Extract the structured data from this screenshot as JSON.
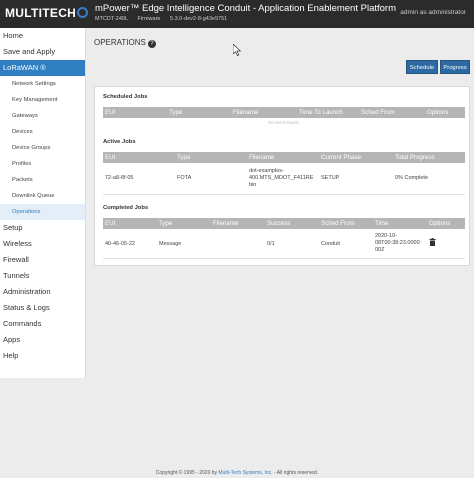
{
  "header": {
    "logo_text": "MULTITECH",
    "title": "mPower™ Edge Intelligence Conduit - Application Enablement Platform",
    "model": "MTCDT-240L",
    "firmware_label": "Firmware",
    "firmware_version": "5.3.0-dev2-8-g43e9751",
    "user_text": "admin as administrator"
  },
  "sidebar": {
    "items_top": [
      {
        "label": "Home"
      },
      {
        "label": "Save and Apply"
      }
    ],
    "active_group": {
      "label": "LoRaWAN ®"
    },
    "sub_items": [
      {
        "label": "Network Settings"
      },
      {
        "label": "Key Management"
      },
      {
        "label": "Gateways"
      },
      {
        "label": "Devices"
      },
      {
        "label": "Device Groups"
      },
      {
        "label": "Profiles"
      },
      {
        "label": "Packets"
      },
      {
        "label": "Downlink Queue"
      },
      {
        "label": "Operations"
      }
    ],
    "items_bottom": [
      {
        "label": "Setup"
      },
      {
        "label": "Wireless"
      },
      {
        "label": "Firewall"
      },
      {
        "label": "Tunnels"
      },
      {
        "label": "Administration"
      },
      {
        "label": "Status & Logs"
      },
      {
        "label": "Commands"
      },
      {
        "label": "Apps"
      },
      {
        "label": "Help"
      }
    ]
  },
  "main": {
    "title": "OPERATIONS",
    "help_icon": "?",
    "buttons": {
      "schedule": "Schedule",
      "progress": "Progress"
    },
    "scheduled": {
      "title": "Scheduled Jobs",
      "columns": [
        "EUI",
        "Type",
        "Filename",
        "Time To Launch",
        "Sched From",
        "Options"
      ],
      "empty_text": "No items found."
    },
    "active": {
      "title": "Active Jobs",
      "columns": [
        "EUI",
        "Type",
        "Filename",
        "Current Phase",
        "Total Progress"
      ],
      "rows": [
        {
          "eui": "72-a8-8f-05",
          "type": "FOTA",
          "filename_l1": "dot-examples-",
          "filename_l2": "400.MTS_MDOT_F411RE",
          "filename_l3": "bin",
          "phase": "SETUP",
          "progress": "0% Complete"
        }
      ]
    },
    "completed": {
      "title": "Completed Jobs",
      "columns": [
        "EUI",
        "Type",
        "Filename",
        "Success",
        "Sched From",
        "Time",
        "Options"
      ],
      "rows": [
        {
          "eui": "40-46-05-22",
          "type": "Message",
          "filename": "",
          "success": "0/1",
          "sched_from": "Conduit",
          "time_l1": "2020-10-",
          "time_l2": "08T00:38:23.0000",
          "time_l3": "00Z",
          "options_icon": "trash-icon"
        }
      ]
    }
  },
  "footer": {
    "prefix": "Copyright © 1995 - 2020 by",
    "link": "Multi-Tech Systems, Inc.",
    "suffix": "- All rights reserved."
  }
}
